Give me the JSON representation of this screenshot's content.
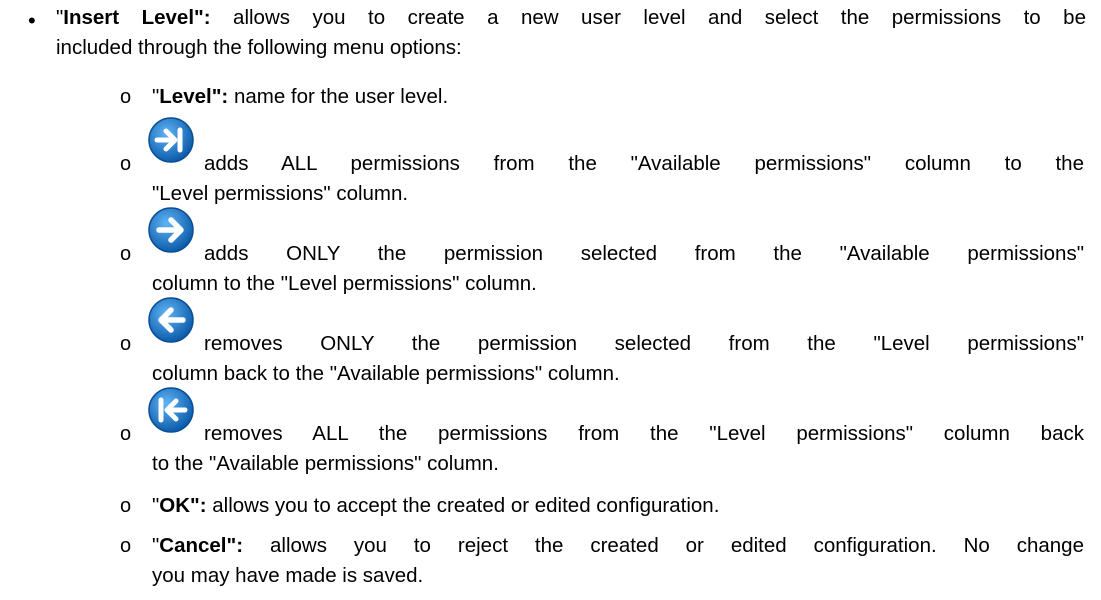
{
  "main": {
    "bullet": "•",
    "title_open_quote": "\"",
    "title": "Insert Level",
    "title_close": "\":",
    "intro_line1": " allows you to create a new user level and select the permissions to be",
    "intro_line2": "included through the following menu options:"
  },
  "items": [
    {
      "marker": "o",
      "open_quote": "\"",
      "term": "Level",
      "close": "\":",
      "desc": " name for the user level."
    },
    {
      "marker": "o",
      "icon": "add-all-arrow-icon",
      "line1": "adds ALL permissions from the \"Available permissions\" column to the",
      "line2": "\"Level permissions\" column."
    },
    {
      "marker": "o",
      "icon": "add-one-arrow-icon",
      "line1": "adds ONLY the permission selected from the \"Available permissions\"",
      "line2": "column to the \"Level permissions\" column."
    },
    {
      "marker": "o",
      "icon": "remove-one-arrow-icon",
      "line1": "removes ONLY the permission selected from the \"Level permissions\"",
      "line2": "column back to the \"Available permissions\" column."
    },
    {
      "marker": "o",
      "icon": "remove-all-arrow-icon",
      "line1": "removes ALL the permissions from the \"Level permissions\" column  back",
      "line2": "to the \"Available permissions\" column."
    },
    {
      "marker": "o",
      "open_quote": "\"",
      "term": "OK",
      "close": "\":",
      "desc": " allows you to accept the created or edited configuration."
    },
    {
      "marker": "o",
      "open_quote": "\"",
      "term": "Cancel",
      "close": "\":",
      "line1": " allows you to reject the created or edited configuration. No change",
      "line2": "you may have made is saved."
    }
  ],
  "colors": {
    "icon_blue": "#1f7fd4",
    "icon_dark": "#0d5cab",
    "text": "#000000"
  }
}
